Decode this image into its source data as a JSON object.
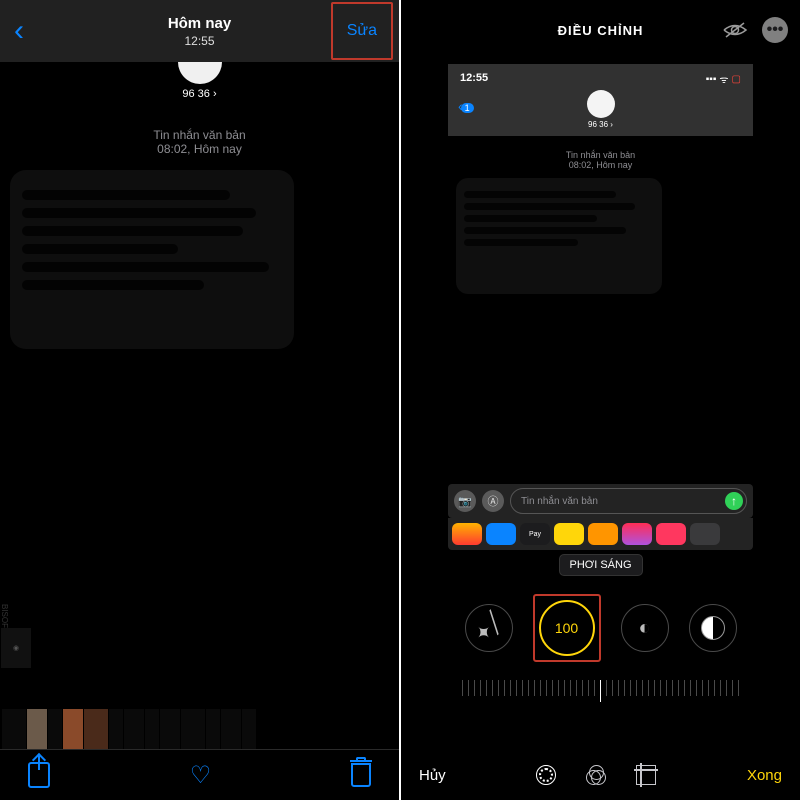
{
  "left": {
    "title": "Hôm nay",
    "header_time": "12:55",
    "edit_label": "Sửa",
    "contact": "96 36 ›",
    "msg_meta_1": "Tin nhắn văn bản",
    "msg_meta_2": "08:02, Hôm nay"
  },
  "right": {
    "title": "ĐIỀU CHỈNH",
    "cancel": "Hủy",
    "done": "Xong",
    "preview": {
      "time": "12:55",
      "signal": "▂▃▅ ⛨",
      "back_badge": "1",
      "contact": "96 36 ›",
      "meta_1": "Tin nhắn văn bản",
      "meta_2": "08:02, Hôm nay",
      "input_placeholder": "Tin nhắn văn bản"
    },
    "tooltip": "PHƠI SÁNG",
    "selected_value": "100",
    "more_dots": "•••"
  }
}
